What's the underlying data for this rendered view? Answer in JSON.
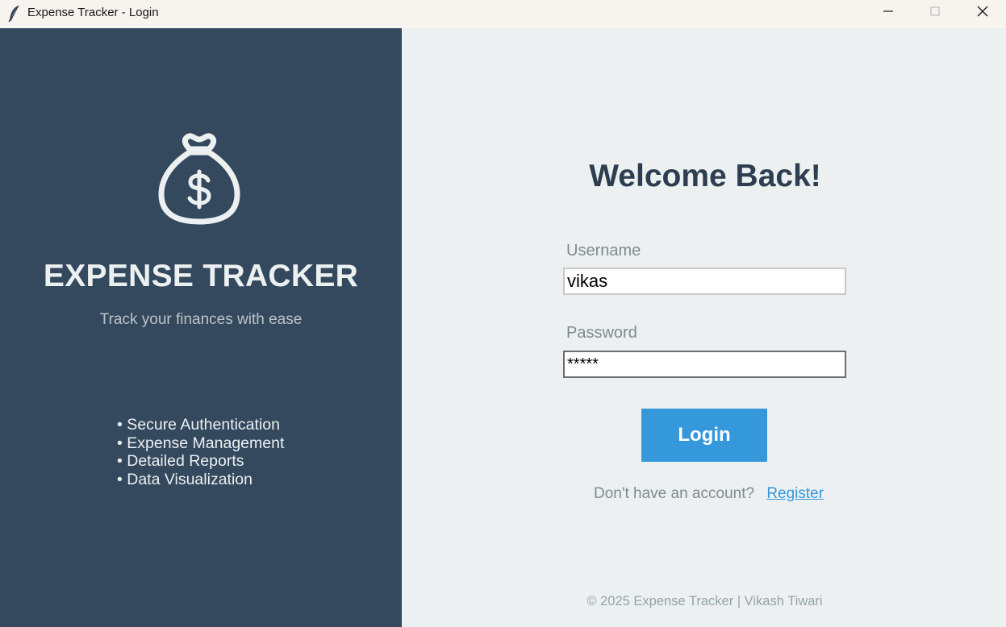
{
  "window": {
    "title": "Expense Tracker - Login",
    "app_icon": "feather-icon",
    "controls": {
      "minimize_icon": "minimize-icon",
      "maximize_icon": "maximize-icon",
      "close_icon": "close-icon"
    }
  },
  "brand": {
    "logo_icon": "money-bag-icon",
    "title": "EXPENSE TRACKER",
    "tagline": "Track your finances with ease",
    "features": [
      "• Secure Authentication",
      "• Expense Management",
      "• Detailed Reports",
      "• Data Visualization"
    ]
  },
  "login": {
    "heading": "Welcome Back!",
    "username_label": "Username",
    "username_value": "vikas",
    "password_label": "Password",
    "password_value": "*****",
    "button_label": "Login",
    "register_prompt": "Don't have an account?",
    "register_link": "Register"
  },
  "footer": {
    "text": "© 2025 Expense Tracker | Vikash Tiwari"
  },
  "colors": {
    "left_panel": "#34495e",
    "right_panel": "#ecf0f1",
    "accent": "#3498db",
    "heading": "#2c3e50",
    "muted": "#7f8c8d"
  }
}
